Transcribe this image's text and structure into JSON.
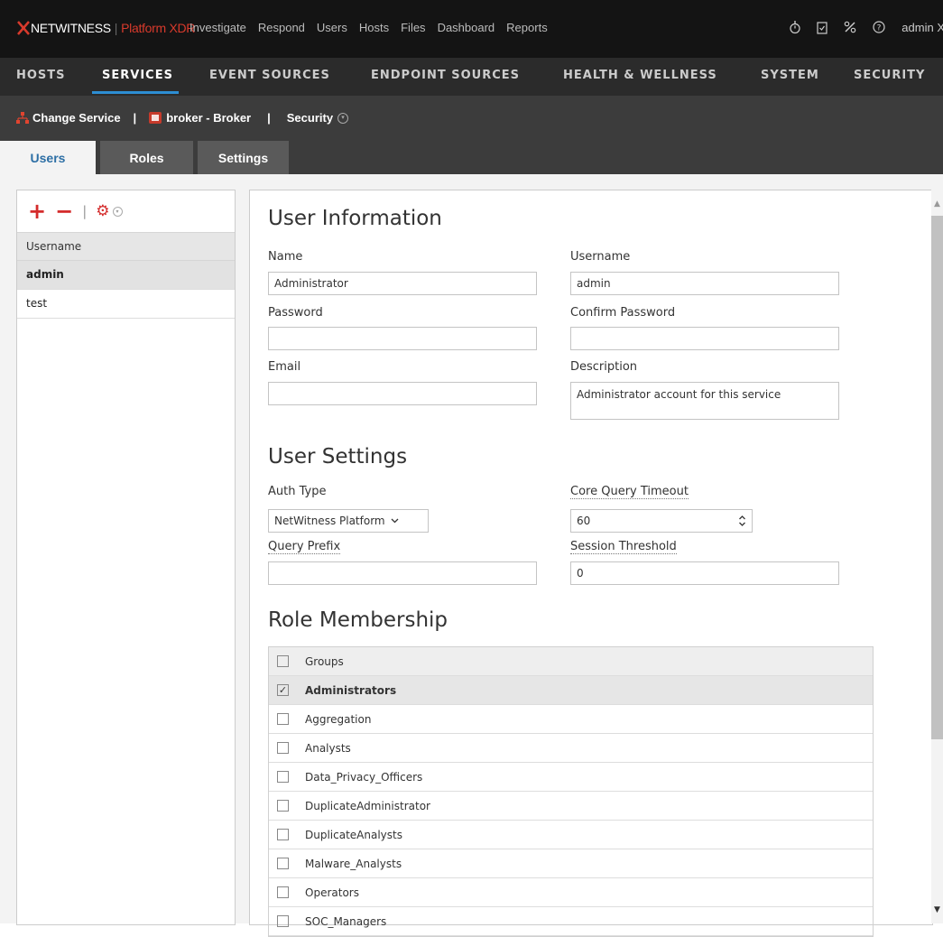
{
  "app": {
    "brand_primary": "NETWITNESS",
    "brand_secondary": "Platform XDR",
    "nav": [
      "Investigate",
      "Respond",
      "Users",
      "Hosts",
      "Files",
      "Dashboard",
      "Reports"
    ],
    "user": "admin",
    "user_suffix": "X",
    "icons": [
      "stopwatch-icon",
      "clipboard-icon",
      "tools-icon",
      "help-icon"
    ],
    "accent_color": "#2d8ed3",
    "brand_color": "#d83a2c"
  },
  "subnav": [
    "HOSTS",
    "SERVICES",
    "EVENT SOURCES",
    "ENDPOINT SOURCES",
    "HEALTH & WELLNESS",
    "SYSTEM",
    "SECURITY"
  ],
  "subnav_active": "SERVICES",
  "service_bar": {
    "change_service": "Change Service",
    "service": "broker - Broker",
    "section": "Security"
  },
  "tabs": [
    "Users",
    "Roles",
    "Settings"
  ],
  "tab_active": "Users",
  "users_panel": {
    "column_header": "Username",
    "rows": [
      "admin",
      "test"
    ],
    "selected": "admin"
  },
  "user_info": {
    "title": "User Information",
    "name_label": "Name",
    "name_value": "Administrator",
    "username_label": "Username",
    "username_value": "admin",
    "password_label": "Password",
    "password_value": "",
    "confirm_label": "Confirm Password",
    "confirm_value": "",
    "email_label": "Email",
    "email_value": "",
    "description_label": "Description",
    "description_value": "Administrator account for this service"
  },
  "user_settings": {
    "title": "User Settings",
    "auth_label": "Auth Type",
    "auth_value": "NetWitness Platform",
    "timeout_label": "Core Query Timeout",
    "timeout_value": "60",
    "prefix_label": "Query Prefix",
    "prefix_value": "",
    "threshold_label": "Session Threshold",
    "threshold_value": "0"
  },
  "roles": {
    "title": "Role Membership",
    "header": "Groups",
    "groups": [
      {
        "name": "Administrators",
        "checked": true
      },
      {
        "name": "Aggregation",
        "checked": false
      },
      {
        "name": "Analysts",
        "checked": false
      },
      {
        "name": "Data_Privacy_Officers",
        "checked": false
      },
      {
        "name": "DuplicateAdministrator",
        "checked": false
      },
      {
        "name": "DuplicateAnalysts",
        "checked": false
      },
      {
        "name": "Malware_Analysts",
        "checked": false
      },
      {
        "name": "Operators",
        "checked": false
      },
      {
        "name": "SOC_Managers",
        "checked": false
      }
    ]
  }
}
